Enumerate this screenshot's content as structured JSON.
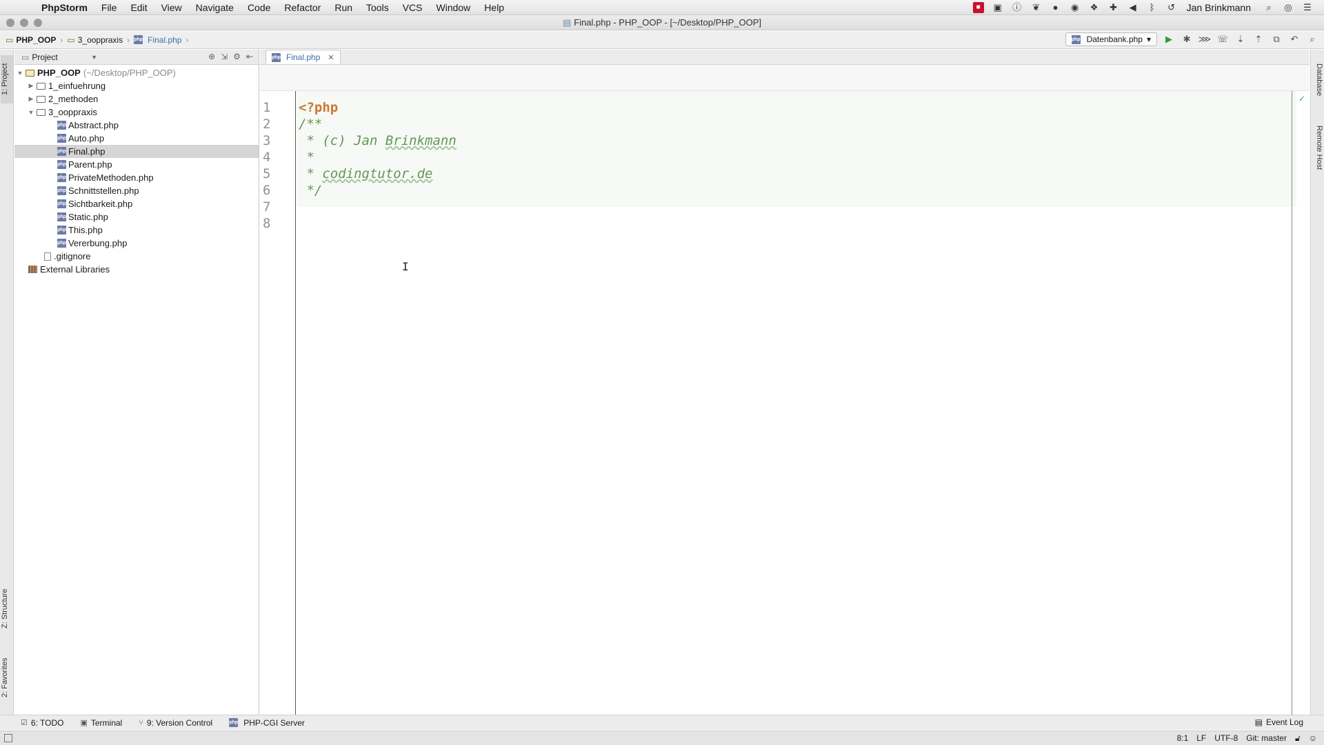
{
  "menubar": {
    "app_name": "PhpStorm",
    "items": [
      "File",
      "Edit",
      "View",
      "Navigate",
      "Code",
      "Refactor",
      "Run",
      "Tools",
      "VCS",
      "Window",
      "Help"
    ],
    "user": "Jan Brinkmann"
  },
  "window": {
    "title": "Final.php - PHP_OOP - [~/Desktop/PHP_OOP]"
  },
  "navbar": {
    "crumbs": [
      "PHP_OOP",
      "3_ooppraxis",
      "Final.php"
    ],
    "run_config": "Datenbank.php"
  },
  "left_stripe": {
    "project": "1: Project",
    "structure": "Z: Structure",
    "favorites": "2: Favorites"
  },
  "right_stripe": {
    "database": "Database",
    "remote_host": "Remote Host"
  },
  "project_panel": {
    "title": "Project",
    "root_name": "PHP_OOP",
    "root_path": "(~/Desktop/PHP_OOP)",
    "folders": [
      "1_einfuehrung",
      "2_methoden",
      "3_ooppraxis"
    ],
    "files": [
      "Abstract.php",
      "Auto.php",
      "Final.php",
      "Parent.php",
      "PrivateMethoden.php",
      "Schnittstellen.php",
      "Sichtbarkeit.php",
      "Static.php",
      "This.php",
      "Vererbung.php"
    ],
    "gitignore": ".gitignore",
    "external": "External Libraries"
  },
  "editor": {
    "tab": "Final.php",
    "line_numbers": [
      "1",
      "2",
      "3",
      "4",
      "5",
      "6",
      "7",
      "8"
    ],
    "lines": {
      "l1": "<?php",
      "l2": "/**",
      "l3_prefix": " * (c) Jan ",
      "l3_typo": "Brinkmann",
      "l4": " *",
      "l5_prefix": " * ",
      "l5_typo": "codingtutor.de",
      "l6": " */"
    }
  },
  "bottom_bar": {
    "todo": "6: TODO",
    "terminal": "Terminal",
    "vcs": "9: Version Control",
    "php_cgi": "PHP-CGI Server",
    "event_log": "Event Log"
  },
  "status_bar": {
    "position": "8:1",
    "line_sep": "LF",
    "encoding": "UTF-8",
    "git": "Git: master"
  },
  "colors": {
    "php_tag": "#cc7832",
    "doc_comment": "#629755",
    "link_blue": "#3a6fa5",
    "run_green": "#2e9d3a"
  }
}
